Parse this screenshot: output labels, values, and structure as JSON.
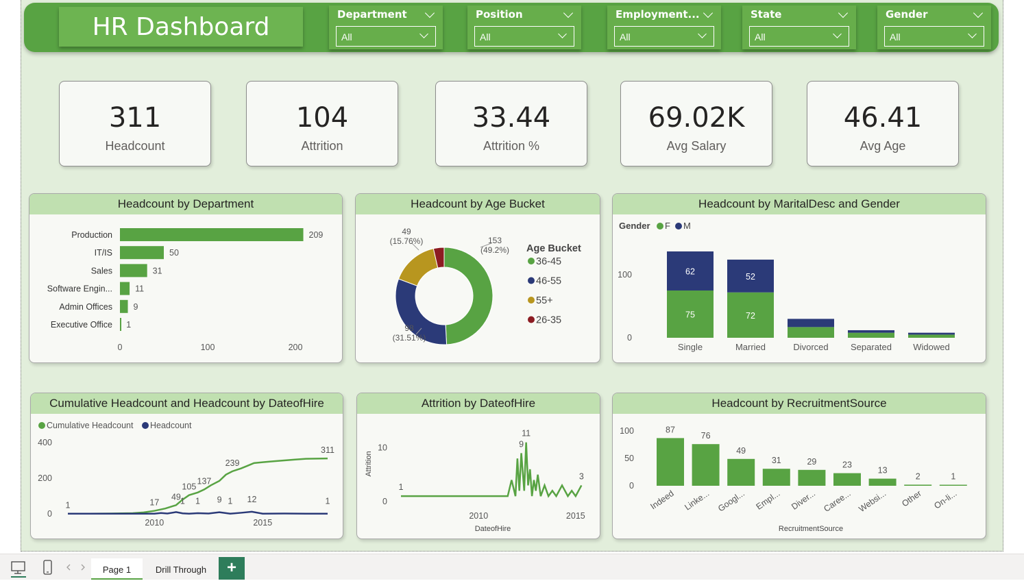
{
  "header": {
    "title": "HR Dashboard"
  },
  "slicers": [
    {
      "label": "Department",
      "value": "All"
    },
    {
      "label": "Position",
      "value": "All"
    },
    {
      "label": "Employment...",
      "value": "All"
    },
    {
      "label": "State",
      "value": "All"
    },
    {
      "label": "Gender",
      "value": "All"
    }
  ],
  "kpis": [
    {
      "value": "311",
      "label": "Headcount"
    },
    {
      "value": "104",
      "label": "Attrition"
    },
    {
      "value": "33.44",
      "label": "Attrition %"
    },
    {
      "value": "69.02K",
      "label": "Avg Salary"
    },
    {
      "value": "46.41",
      "label": "Avg Age"
    }
  ],
  "colors": {
    "green": "#58a343",
    "navy": "#2b3a78",
    "gold": "#b8961f",
    "red": "#8c1c22",
    "header_bg": "#c0e0b0",
    "canvas": "#e2eedb"
  },
  "chart_data": [
    {
      "id": "dept",
      "type": "bar",
      "orientation": "horizontal",
      "title": "Headcount by Department",
      "categories": [
        "Production",
        "IT/IS",
        "Sales",
        "Software Engin...",
        "Admin Offices",
        "Executive Office"
      ],
      "values": [
        209,
        50,
        31,
        11,
        9,
        1
      ],
      "xticks": [
        "0",
        "100",
        "200"
      ],
      "xlim": [
        0,
        220
      ]
    },
    {
      "id": "age",
      "type": "pie",
      "title": "Headcount by Age Bucket",
      "legend_title": "Age Bucket",
      "slices": [
        {
          "label": "36-45",
          "value": 153,
          "pct": "(49.2%)",
          "color": "#58a343"
        },
        {
          "label": "46-55",
          "value": 98,
          "pct": "(31.51%)",
          "color": "#2b3a78"
        },
        {
          "label": "55+",
          "value": 49,
          "pct": "(15.76%)",
          "color": "#b8961f"
        },
        {
          "label": "26-35",
          "value": 11,
          "pct": "",
          "color": "#8c1c22"
        }
      ]
    },
    {
      "id": "marital",
      "type": "bar",
      "stacked": true,
      "title": "Headcount by MaritalDesc and Gender",
      "legend_title": "Gender",
      "categories": [
        "Single",
        "Married",
        "Divorced",
        "Separated",
        "Widowed"
      ],
      "series": [
        {
          "name": "F",
          "values": [
            75,
            72,
            17,
            8,
            5
          ],
          "labels": [
            "75",
            "72",
            "",
            "",
            ""
          ],
          "color": "#58a343"
        },
        {
          "name": "M",
          "values": [
            62,
            52,
            13,
            4,
            3
          ],
          "labels": [
            "62",
            "52",
            "",
            "",
            ""
          ],
          "color": "#2b3a78"
        }
      ],
      "yticks": [
        "0",
        "100"
      ],
      "ylim": [
        0,
        150
      ]
    },
    {
      "id": "cumulative",
      "type": "line",
      "title": "Cumulative Headcount and Headcount by DateofHire",
      "series": [
        {
          "name": "Cumulative Headcount",
          "color": "#58a343",
          "x": [
            2006.0,
            2007.0,
            2008.0,
            2009.0,
            2009.5,
            2010.0,
            2010.5,
            2011.0,
            2011.3,
            2011.6,
            2012.0,
            2012.3,
            2012.6,
            2013.0,
            2013.3,
            2013.6,
            2014.0,
            2014.3,
            2014.6,
            2015.0,
            2015.5,
            2016.0,
            2016.5,
            2017.0,
            2018.0
          ],
          "y": [
            1,
            1,
            2,
            4,
            8,
            17,
            30,
            49,
            80,
            105,
            120,
            137,
            160,
            185,
            220,
            239,
            255,
            270,
            285,
            290,
            295,
            300,
            305,
            309,
            311
          ]
        },
        {
          "name": "Headcount",
          "color": "#2b3a78",
          "x": [
            2006.0,
            2007.0,
            2008.0,
            2009.0,
            2010.0,
            2010.3,
            2010.6,
            2011.0,
            2011.3,
            2011.6,
            2012.0,
            2012.5,
            2013.0,
            2013.5,
            2014.0,
            2014.5,
            2015.0,
            2016.0,
            2017.0,
            2018.0
          ],
          "y": [
            1,
            1,
            1,
            1,
            1,
            5,
            2,
            10,
            3,
            1,
            4,
            2,
            9,
            1,
            6,
            12,
            1,
            2,
            1,
            1
          ]
        }
      ],
      "labels": [
        {
          "series": 0,
          "x": 2006.0,
          "y": 1,
          "text": "1"
        },
        {
          "series": 0,
          "x": 2010.0,
          "y": 17,
          "text": "17"
        },
        {
          "series": 0,
          "x": 2011.0,
          "y": 49,
          "text": "49"
        },
        {
          "series": 0,
          "x": 2011.6,
          "y": 105,
          "text": "105"
        },
        {
          "series": 0,
          "x": 2012.3,
          "y": 137,
          "text": "137"
        },
        {
          "series": 0,
          "x": 2013.6,
          "y": 239,
          "text": "239"
        },
        {
          "series": 0,
          "x": 2018.0,
          "y": 311,
          "text": "311"
        },
        {
          "series": 1,
          "x": 2011.3,
          "y": 1,
          "text": "1"
        },
        {
          "series": 1,
          "x": 2012.0,
          "y": 1,
          "text": "1"
        },
        {
          "series": 1,
          "x": 2013.0,
          "y": 9,
          "text": "9"
        },
        {
          "series": 1,
          "x": 2013.5,
          "y": 1,
          "text": "1"
        },
        {
          "series": 1,
          "x": 2014.5,
          "y": 12,
          "text": "12"
        },
        {
          "series": 1,
          "x": 2018.0,
          "y": 1,
          "text": "1"
        }
      ],
      "yticks": [
        "0",
        "200",
        "400"
      ],
      "ylim": [
        0,
        400
      ],
      "xticks": [
        "2010",
        "2015"
      ],
      "xlim": [
        2006,
        2018
      ]
    },
    {
      "id": "attrition",
      "type": "line",
      "title": "Attrition by DateofHire",
      "xlabel": "DateofHire",
      "ylabel": "Attrition",
      "series": [
        {
          "name": "Attrition",
          "color": "#58a343",
          "x": [
            2006.0,
            2009.0,
            2011.0,
            2011.5,
            2011.7,
            2011.9,
            2012.0,
            2012.1,
            2012.2,
            2012.35,
            2012.45,
            2012.55,
            2012.65,
            2012.75,
            2012.85,
            2012.95,
            2013.05,
            2013.2,
            2013.4,
            2013.6,
            2013.8,
            2014.0,
            2014.3,
            2014.6,
            2014.8,
            2015.0,
            2015.3
          ],
          "y": [
            1,
            1,
            1,
            1,
            4,
            1,
            8,
            2,
            9,
            2,
            11,
            3,
            6,
            1,
            4,
            2,
            5,
            1,
            3,
            1,
            2,
            1,
            3,
            1,
            2,
            1,
            3
          ]
        }
      ],
      "labels": [
        {
          "x": 2006.0,
          "y": 1,
          "text": "1"
        },
        {
          "x": 2012.2,
          "y": 9,
          "text": "9"
        },
        {
          "x": 2012.45,
          "y": 11,
          "text": "11"
        },
        {
          "x": 2015.3,
          "y": 3,
          "text": "3"
        }
      ],
      "yticks": [
        "0",
        "10"
      ],
      "ylim": [
        0,
        13
      ],
      "xticks": [
        "2010",
        "2015"
      ],
      "xlim": [
        2006,
        2015.5
      ]
    },
    {
      "id": "recruit",
      "type": "bar",
      "title": "Headcount by RecruitmentSource",
      "xlabel": "RecruitmentSource",
      "categories": [
        "Indeed",
        "Linke...",
        "Googl...",
        "Empl...",
        "Diver...",
        "Caree...",
        "Websi...",
        "Other",
        "On-li..."
      ],
      "values": [
        87,
        76,
        49,
        31,
        29,
        23,
        13,
        2,
        1
      ],
      "yticks": [
        "0",
        "50",
        "100"
      ],
      "ylim": [
        0,
        100
      ]
    }
  ],
  "tabs": {
    "page1": "Page 1",
    "drill": "Drill Through",
    "add": "+"
  }
}
